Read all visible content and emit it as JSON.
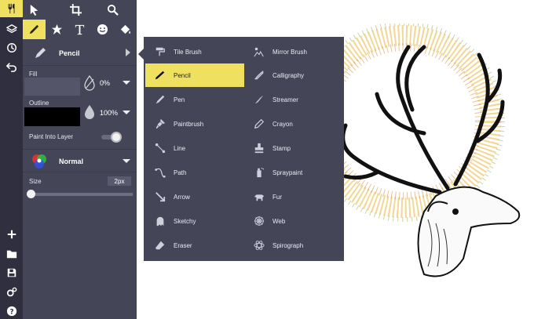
{
  "toolbar_icons": [
    "brushes-icon",
    "select-icon",
    "crop-icon",
    "search-icon"
  ],
  "brush_tools": [
    "brush-icon",
    "star-icon",
    "text-icon",
    "emoji-icon",
    "fill-bucket-icon"
  ],
  "brush_panel": {
    "selected_brush": "Pencil",
    "fill_label": "Fill",
    "fill_opacity": "0%",
    "outline_label": "Outline",
    "outline_opacity": "100%",
    "paint_into_layer": "Paint Into Layer",
    "blend_mode": "Normal",
    "size_label": "Size",
    "size_value": "2px"
  },
  "brush_menu": {
    "left_column": [
      {
        "label": "Tile Brush",
        "icon": "paint-roller-icon"
      },
      {
        "label": "Pencil",
        "icon": "pencil-icon",
        "selected": true
      },
      {
        "label": "Pen",
        "icon": "pen-icon"
      },
      {
        "label": "Paintbrush",
        "icon": "paintbrush-icon"
      },
      {
        "label": "Line",
        "icon": "line-icon"
      },
      {
        "label": "Path",
        "icon": "path-icon"
      },
      {
        "label": "Arrow",
        "icon": "arrow-icon"
      },
      {
        "label": "Sketchy",
        "icon": "ghost-icon"
      },
      {
        "label": "Eraser",
        "icon": "eraser-icon"
      }
    ],
    "right_column": [
      {
        "label": "Mirror Brush",
        "icon": "mirror-icon"
      },
      {
        "label": "Calligraphy",
        "icon": "calligraphy-icon"
      },
      {
        "label": "Streamer",
        "icon": "streamer-icon"
      },
      {
        "label": "Crayon",
        "icon": "crayon-icon"
      },
      {
        "label": "Stamp",
        "icon": "stamp-icon"
      },
      {
        "label": "Spraypaint",
        "icon": "spraypaint-icon"
      },
      {
        "label": "Fur",
        "icon": "fur-icon"
      },
      {
        "label": "Web",
        "icon": "web-icon"
      },
      {
        "label": "Spirograph",
        "icon": "spirograph-icon"
      }
    ]
  },
  "sidebar_bottom_icons": [
    "add-icon",
    "folder-icon",
    "save-icon",
    "settings-icon",
    "help-icon"
  ],
  "colors": {
    "accent": "#f0e060",
    "panel": "#454558",
    "rail": "#2f2f3f"
  }
}
